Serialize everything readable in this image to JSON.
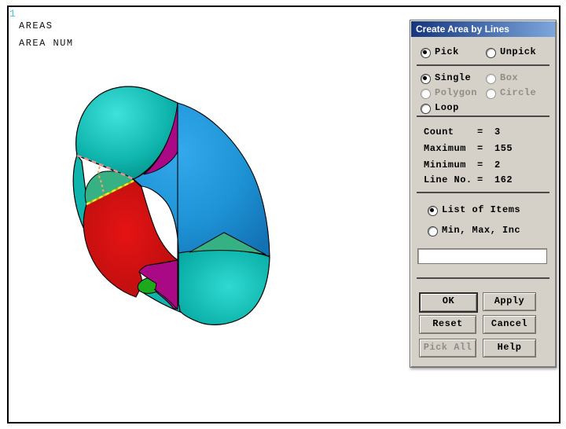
{
  "viewport": {
    "plot_number": "1",
    "label_areas": "AREAS",
    "label_area_num": "AREA NUM"
  },
  "model": {
    "description": "3D torus volume shown with colored area patches; three picked lines highlighted with dashed pink, yellow-green and orange outlines",
    "colors": {
      "teal_light": "#3FE2DA",
      "teal": "#0FB4AC",
      "teal_dark": "#00837C",
      "teal2_light": "#2FDAD2",
      "teal2_dark": "#009D96",
      "blue_light": "#33A9EC",
      "blue": "#1E93D6",
      "blue_dark": "#1272B4",
      "red_light": "#E61313",
      "red_dark": "#AD0D0D",
      "magenta": "#A90985",
      "green": "#1EA81E",
      "sea_green": "#36B183",
      "pick_pink": "#F29090",
      "pick_yellow": "#FFE81E",
      "pick_green": "#8CCB1E",
      "pick_orange": "#F2A266",
      "outline": "#000000",
      "plot_number_color": "#3FC8DC"
    }
  },
  "dialog": {
    "title": "Create Area by Lines",
    "colors": {
      "panel": "#D5D1C9",
      "title_from": "#16367E",
      "title_to": "#7CA6DC"
    },
    "pick_options": [
      {
        "label": "Pick",
        "selected": true,
        "disabled": false
      },
      {
        "label": "Unpick",
        "selected": false,
        "disabled": false
      }
    ],
    "mode_options": [
      {
        "label": "Single",
        "selected": true,
        "disabled": false
      },
      {
        "label": "Box",
        "selected": false,
        "disabled": true
      },
      {
        "label": "Polygon",
        "selected": false,
        "disabled": true
      },
      {
        "label": "Circle",
        "selected": false,
        "disabled": true
      },
      {
        "label": "Loop",
        "selected": false,
        "disabled": false
      }
    ],
    "stats": {
      "eq": "=",
      "rows": [
        {
          "label": "Count",
          "value": "3"
        },
        {
          "label": "Maximum",
          "value": "155"
        },
        {
          "label": "Minimum",
          "value": "2"
        },
        {
          "label": "Line No.",
          "value": "162"
        }
      ]
    },
    "list_options": [
      {
        "label": "List of Items",
        "selected": true
      },
      {
        "label": "Min, Max, Inc",
        "selected": false
      }
    ],
    "input": {
      "value": ""
    },
    "buttons": [
      {
        "label": "OK",
        "default": true,
        "disabled": false
      },
      {
        "label": "Apply",
        "default": false,
        "disabled": false
      },
      {
        "label": "Reset",
        "default": false,
        "disabled": false
      },
      {
        "label": "Cancel",
        "default": false,
        "disabled": false
      },
      {
        "label": "Pick All",
        "default": false,
        "disabled": true
      },
      {
        "label": "Help",
        "default": false,
        "disabled": false
      }
    ]
  }
}
